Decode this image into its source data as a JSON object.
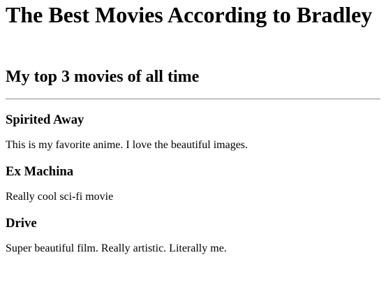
{
  "page": {
    "title": "The Best Movies According to Bradley",
    "subtitle": "My top 3 movies of all time"
  },
  "movies": [
    {
      "title": "Spirited Away",
      "description": "This is my favorite anime. I love the beautiful images."
    },
    {
      "title": "Ex Machina",
      "description": "Really cool sci-fi movie"
    },
    {
      "title": "Drive",
      "description": "Super beautiful film. Really artistic. Literally me."
    }
  ]
}
